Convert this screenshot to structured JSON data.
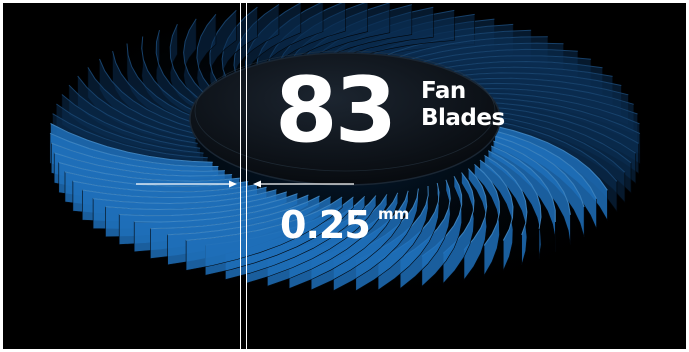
{
  "blade_count": "83",
  "blade_label": {
    "line1": "Fan",
    "line2": "Blades"
  },
  "spacing": {
    "value": "0.25",
    "unit": "mm"
  },
  "colors": {
    "background": "#000000",
    "blade_dark": "#0b2d52",
    "blade_bright": "#1f6fb8",
    "hub": "#0d1117",
    "text": "#ffffff"
  },
  "icons": [
    "arrow-right-icon",
    "arrow-left-icon"
  ]
}
